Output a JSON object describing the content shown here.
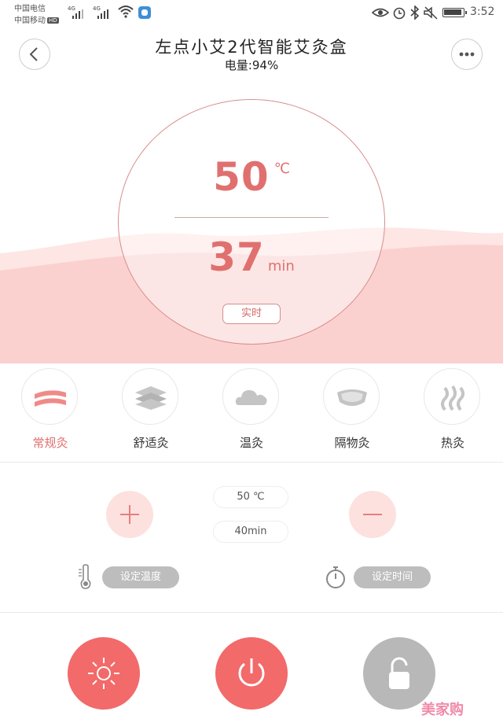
{
  "status_bar": {
    "carrier_1": "中国电信",
    "carrier_2": "中国移动",
    "hd": "HD",
    "net_1": "4G",
    "net_2": "4G",
    "time": "3:52"
  },
  "header": {
    "title": "左点小艾2代智能艾灸盒",
    "battery_label": "电量:94%"
  },
  "display": {
    "temperature": "50",
    "temperature_unit": "℃",
    "duration": "37",
    "duration_unit": "min",
    "mode_badge": "实时"
  },
  "modes": [
    {
      "label": "常规灸",
      "icon": "stripes-icon",
      "active": true
    },
    {
      "label": "舒适灸",
      "icon": "layers-icon",
      "active": false
    },
    {
      "label": "温灸",
      "icon": "cloud-icon",
      "active": false
    },
    {
      "label": "隔物灸",
      "icon": "pad-icon",
      "active": false
    },
    {
      "label": "热灸",
      "icon": "heat-icon",
      "active": false
    }
  ],
  "settings": {
    "temperature_value": "50 ℃",
    "time_value": "40min",
    "set_temperature_label": "设定温度",
    "set_time_label": "设定时间"
  },
  "watermark": "美家购",
  "colors": {
    "accent": "#f26a6a",
    "accent_text": "#e0706f",
    "wave": "#fad1cf",
    "inactive": "#b8b8b8"
  }
}
